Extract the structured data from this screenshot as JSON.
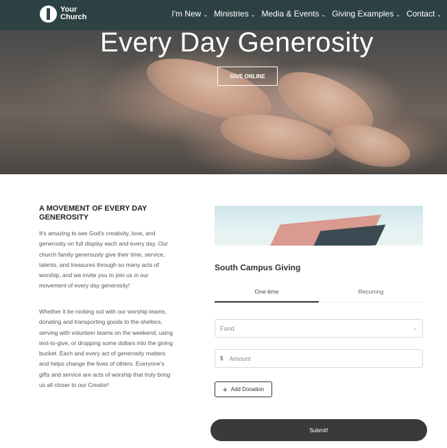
{
  "header": {
    "logo_line1": "Your",
    "logo_line2": "Church",
    "nav": [
      {
        "label": "I'm New"
      },
      {
        "label": "Ministries"
      },
      {
        "label": "Media & Events"
      },
      {
        "label": "Giving Examples"
      },
      {
        "label": "Contact"
      }
    ]
  },
  "hero": {
    "title": "Every Day Generosity",
    "button_label": "GIVE ONLINE"
  },
  "intro": {
    "heading": "A MOVEMENT OF EVERY DAY GENEROSITY",
    "paragraph1": "It's amazing to see God's creativity, love, and generosity on full display each and every day. Our church family generously give their time, service, talents, and treasures through so many acts of worship, and we invite you to join us in our movement of every day generosity!",
    "paragraph2": "Whether it be rocking out with our worship teams, donating and transporting goods to the shelters, serving with volunteer teams on the weekend, using text-to-give, or dropping some dollars into the giving bucket. Each and every act of generosity matters and helps change the lives of others. Everyone's gifts and service are acts of worship that truly bring us all closer to our Creator!"
  },
  "giving_form": {
    "title": "South Campus Giving",
    "tabs": [
      {
        "label": "One-time",
        "active": true
      },
      {
        "label": "Recurring",
        "active": false
      }
    ],
    "fund_placeholder": "Fund",
    "currency_symbol": "$",
    "amount_placeholder": "Amount",
    "add_donation_label": "Add Donation",
    "submit_label": "Submit!"
  },
  "icons": {
    "logo": "church-logo-icon",
    "chevron": "chevron-down-icon",
    "plus": "plus-icon"
  }
}
